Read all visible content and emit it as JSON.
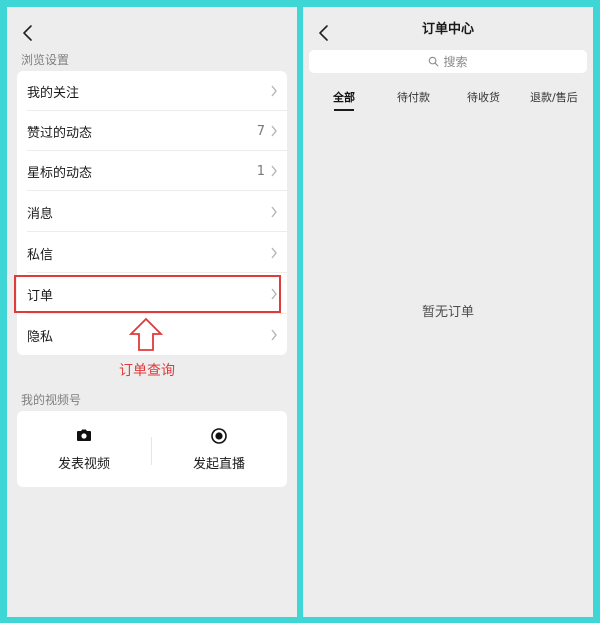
{
  "left": {
    "section_browse": "浏览设置",
    "items": [
      {
        "label": "我的关注",
        "count": ""
      },
      {
        "label": "赞过的动态",
        "count": "7"
      },
      {
        "label": "星标的动态",
        "count": "1"
      },
      {
        "label": "消息",
        "count": ""
      },
      {
        "label": "私信",
        "count": ""
      },
      {
        "label": "订单",
        "count": ""
      },
      {
        "label": "隐私",
        "count": ""
      }
    ],
    "annotation": "订单查询",
    "section_channel": "我的视频号",
    "channel_buttons": [
      "发表视频",
      "发起直播"
    ],
    "highlight_color": "#e03a3a"
  },
  "right": {
    "title": "订单中心",
    "search_placeholder": "搜索",
    "tabs": [
      "全部",
      "待付款",
      "待收货",
      "退款/售后"
    ],
    "active_tab": "全部",
    "empty_message": "暂无订单"
  },
  "colors": {
    "border": "#3fd6d6",
    "panel_bg": "#ededed",
    "card_bg": "#ffffff",
    "annotation": "#e03a3a"
  }
}
